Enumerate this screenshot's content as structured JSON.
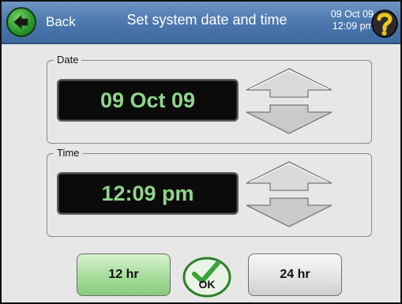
{
  "header": {
    "back_label": "Back",
    "title": "Set system date and time",
    "clock_date": "09 Oct 09",
    "clock_time": "12:09 pm"
  },
  "date_group": {
    "legend": "Date",
    "value": "09 Oct 09"
  },
  "time_group": {
    "legend": "Time",
    "value": "12:09 pm"
  },
  "buttons": {
    "twelve_hr": "12 hr",
    "ok": "OK",
    "twenty_four_hr": "24 hr"
  },
  "icons": {
    "back": "back-arrow-icon",
    "help": "question-mark-icon",
    "ok": "checkmark-icon",
    "up": "up-arrow-icon",
    "down": "down-arrow-icon"
  },
  "colors": {
    "header": "#4f7ab0",
    "display_text": "#8fd68a",
    "selected_button": "#a6dd9b",
    "back_button": "#2e9a2b",
    "help_icon": "#f0c419"
  }
}
